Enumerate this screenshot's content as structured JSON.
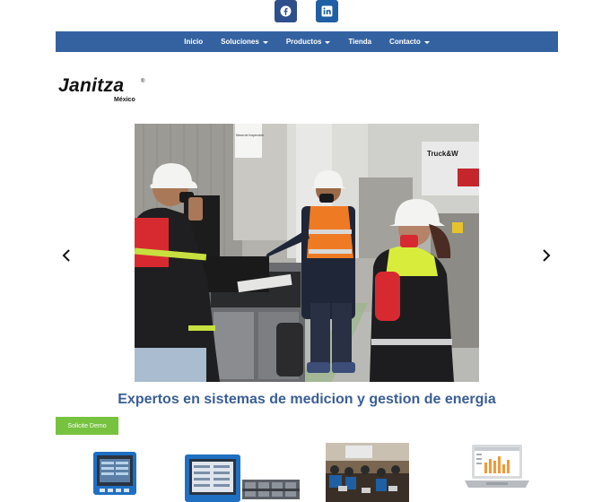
{
  "social": {
    "facebook_icon": "facebook-icon",
    "linkedin_icon": "linkedin-icon"
  },
  "nav": {
    "items": [
      {
        "label": "Inicio",
        "dropdown": false
      },
      {
        "label": "Soluciones",
        "dropdown": true
      },
      {
        "label": "Productos",
        "dropdown": true
      },
      {
        "label": "Tienda",
        "dropdown": false
      },
      {
        "label": "Contacto",
        "dropdown": true
      }
    ]
  },
  "brand": {
    "name": "Janitza",
    "registered": "®",
    "region": "México"
  },
  "carousel": {
    "prev_icon": "chevron-left-icon",
    "next_icon": "chevron-right-icon",
    "sign_text": "Mesa de Inspección",
    "truck_text": "Truck&W"
  },
  "hero": {
    "headline": "Expertos en sistemas de medicion y gestion de energia"
  },
  "cta": {
    "demo_label": "Solicite Demo"
  },
  "colors": {
    "nav_bg": "#3462a0",
    "headline": "#3a5e95",
    "cta_bg": "#77c23e",
    "facebook": "#2e4f8c",
    "linkedin": "#1f5fa3"
  }
}
